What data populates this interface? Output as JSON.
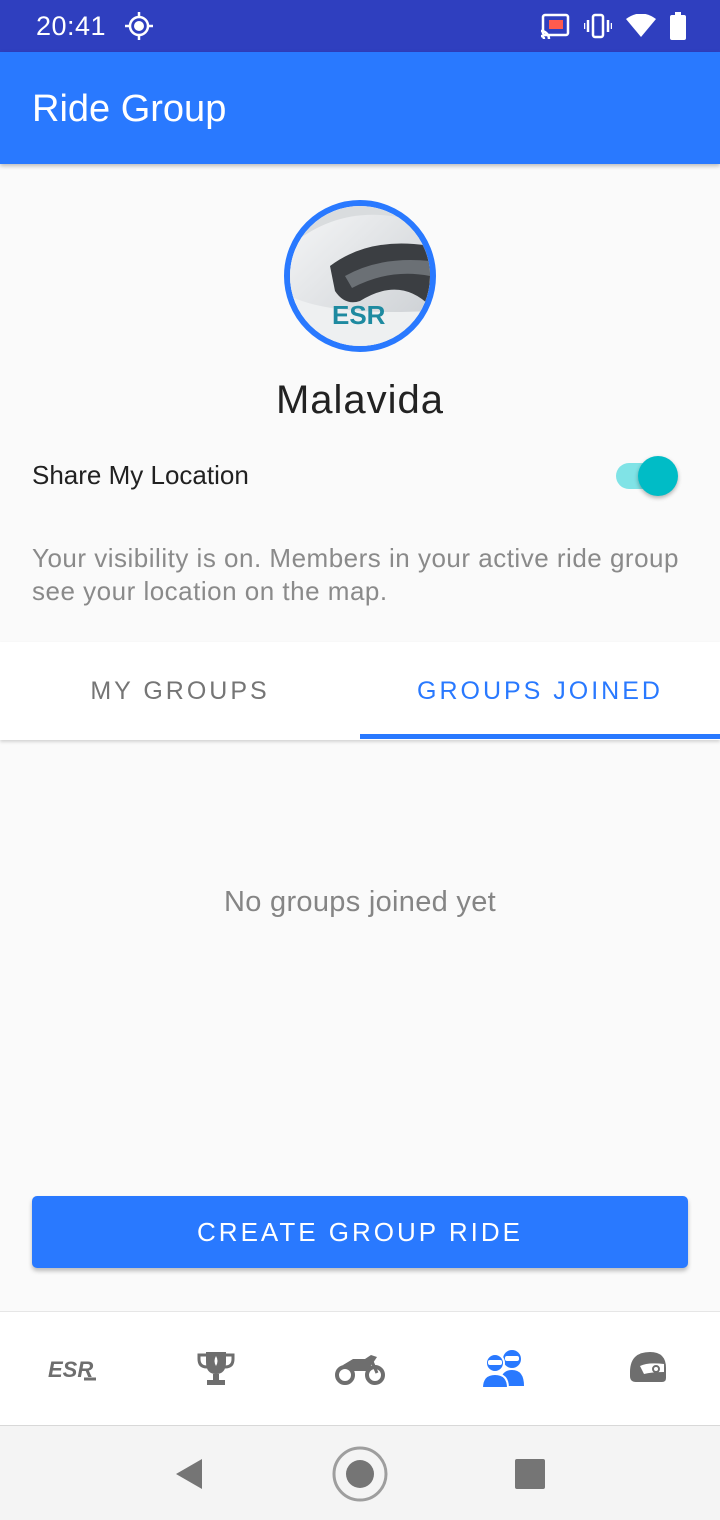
{
  "status_bar": {
    "time": "20:41",
    "left_icon": "location-crosshair-icon",
    "right_icons": [
      "cast-icon",
      "vibrate-icon",
      "wifi-icon",
      "battery-icon"
    ]
  },
  "app_bar": {
    "title": "Ride Group"
  },
  "profile": {
    "name": "Malavida",
    "avatar_icon": "helmet-avatar",
    "avatar_logo_text": "ESR"
  },
  "share_location": {
    "label": "Share My Location",
    "enabled": true
  },
  "visibility_message": "Your visibility is on. Members in your active ride group see your location on the map.",
  "tabs": [
    {
      "label": "MY GROUPS",
      "active": false
    },
    {
      "label": "GROUPS JOINED",
      "active": true
    }
  ],
  "empty_state": "No groups joined yet",
  "create_button": {
    "label": "CREATE GROUP RIDE"
  },
  "bottom_nav": {
    "items": [
      {
        "icon": "esr-logo-icon",
        "active": false
      },
      {
        "icon": "trophy-icon",
        "active": false
      },
      {
        "icon": "motorcycle-icon",
        "active": false
      },
      {
        "icon": "riders-group-icon",
        "active": true
      },
      {
        "icon": "helmet-icon",
        "active": false
      }
    ],
    "logo_text": "ESR"
  },
  "system_nav": [
    "back-icon",
    "home-icon",
    "recents-icon"
  ],
  "colors": {
    "status_bar": "#2f3fbf",
    "primary": "#2979ff",
    "toggle_thumb": "#00bcc6",
    "toggle_track": "#80e3e6",
    "nav_inactive": "#6e6e6e"
  }
}
